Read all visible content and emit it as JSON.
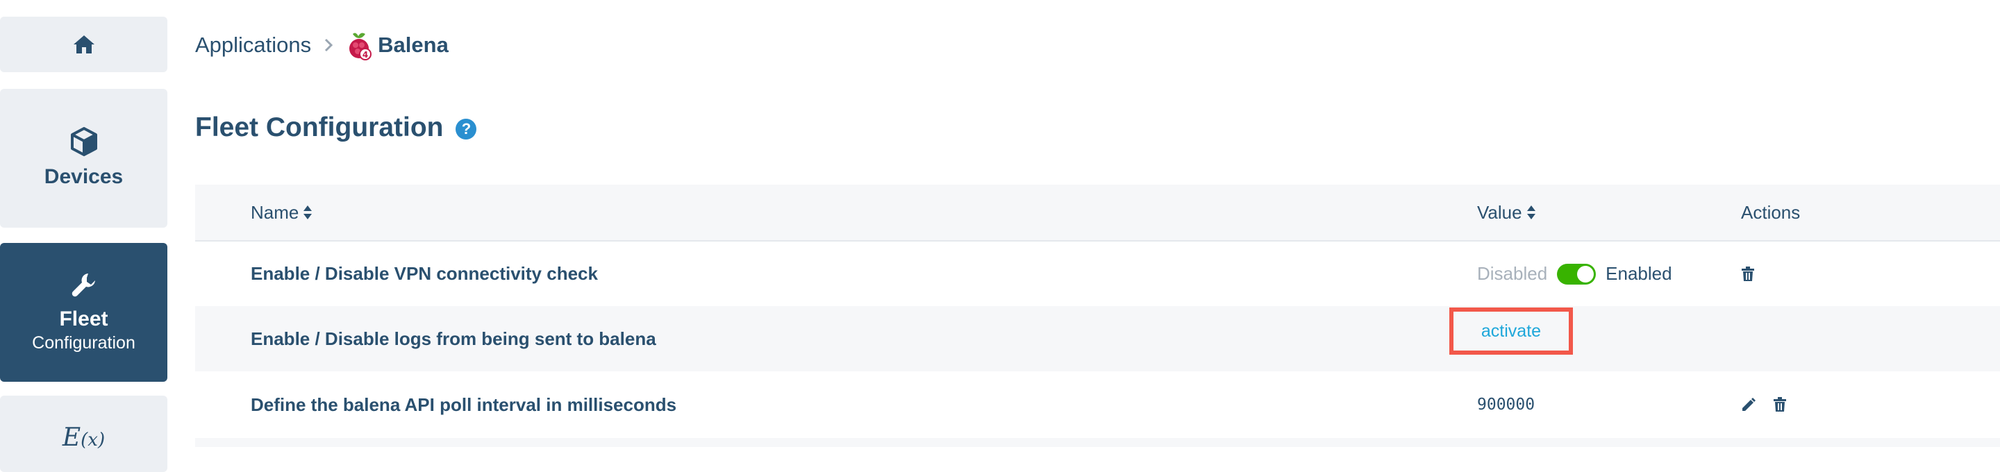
{
  "sidebar": {
    "home_icon": "home-icon",
    "devices": {
      "icon": "cube-icon",
      "label": "Devices"
    },
    "fleet": {
      "icon": "wrench-icon",
      "label": "Fleet",
      "sublabel": "Configuration"
    },
    "variables": {
      "icon": "function-icon",
      "glyph": "E",
      "sub": "(x)"
    }
  },
  "breadcrumb": {
    "root": "Applications",
    "separator_icon": "chevron-right-icon",
    "current": "Balena",
    "current_icon": "raspberry-pi-icon"
  },
  "page": {
    "title": "Fleet Configuration",
    "help_icon": "help-icon",
    "help_glyph": "?"
  },
  "table": {
    "headers": {
      "name": "Name",
      "value": "Value",
      "actions": "Actions"
    },
    "rows": [
      {
        "name": "Enable / Disable VPN connectivity check",
        "off_label": "Disabled",
        "on_label": "Enabled",
        "toggle_on": true
      },
      {
        "name": "Enable / Disable logs from being sent to balena",
        "link": "activate"
      },
      {
        "name": "Define the balena API poll interval in milliseconds",
        "value": "900000"
      }
    ]
  },
  "colors": {
    "primary": "#2a506f",
    "sidebar_bg": "#eceff3",
    "active_bg": "#2a506f",
    "toggle_on": "#38b300",
    "link": "#1ea7da",
    "highlight": "#f2584a"
  }
}
